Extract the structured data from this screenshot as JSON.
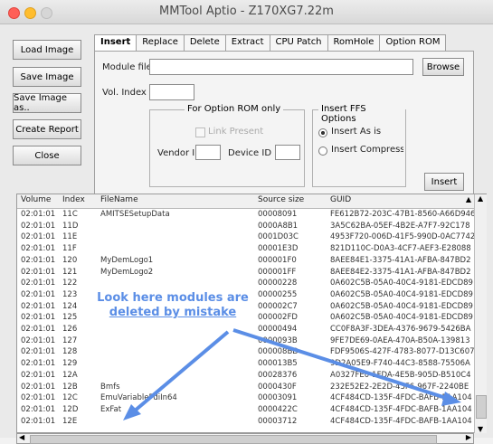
{
  "window": {
    "title": "MMTool Aptio - Z170XG7.22m"
  },
  "colors": {
    "annotation": "#5b8ee6",
    "close": "#ff5f57",
    "minimize": "#ffbd2e",
    "zoom": "#d6d6d6"
  },
  "left_buttons": [
    "Load Image",
    "Save Image",
    "Save Image as..",
    "Create Report",
    "Close"
  ],
  "tabs": [
    "Insert",
    "Replace",
    "Delete",
    "Extract",
    "CPU Patch",
    "RomHole",
    "Option ROM"
  ],
  "insert_panel": {
    "module_file_label": "Module file",
    "module_file_value": "",
    "browse": "Browse",
    "vol_index_label": "Vol. Index",
    "vol_index_value": "",
    "option_rom_group": "For Option ROM only",
    "link_present": "Link Present",
    "vendor_id": "Vendor ID",
    "device_id": "Device ID",
    "ffs_group": "Insert FFS Options",
    "insert_as_is": "Insert As is",
    "insert_compressed": "Insert Compressed",
    "insert_button": "Insert"
  },
  "table": {
    "columns": [
      "Volume",
      "Index",
      "FileName",
      "Source size",
      "GUID"
    ],
    "rows": [
      [
        "02:01:01",
        "11C",
        "AMITSESetupData",
        "00008091",
        "FE612B72-203C-47B1-8560-A66D946"
      ],
      [
        "02:01:01",
        "11D",
        "",
        "0000A8B1",
        "3A5C62BA-05EF-4B2E-A7F7-92C178"
      ],
      [
        "02:01:01",
        "11E",
        "",
        "0001D03C",
        "4953F720-006D-41F5-990D-0AC7742"
      ],
      [
        "02:01:01",
        "11F",
        "",
        "00001E3D",
        "821D110C-D0A3-4CF7-AEF3-E28088"
      ],
      [
        "02:01:01",
        "120",
        "MyDemLogo1",
        "000001F0",
        "8AEE84E1-3375-41A1-AFBA-847BD2"
      ],
      [
        "02:01:01",
        "121",
        "MyDemLogo2",
        "000001FF",
        "8AEE84E2-3375-41A1-AFBA-847BD2"
      ],
      [
        "02:01:01",
        "122",
        "",
        "00000228",
        "0A602C5B-05A0-40C4-9181-EDCD89"
      ],
      [
        "02:01:01",
        "123",
        "",
        "00000255",
        "0A602C5B-05A0-40C4-9181-EDCD89"
      ],
      [
        "02:01:01",
        "124",
        "",
        "000002C7",
        "0A602C5B-05A0-40C4-9181-EDCD89"
      ],
      [
        "02:01:01",
        "125",
        "",
        "000002FD",
        "0A602C5B-05A0-40C4-9181-EDCD89"
      ],
      [
        "02:01:01",
        "126",
        "",
        "00000494",
        "CC0F8A3F-3DEA-4376-9679-5426BA"
      ],
      [
        "02:01:01",
        "127",
        "",
        "0000093B",
        "9FE7DE69-0AEA-470A-B50A-139813"
      ],
      [
        "02:01:01",
        "128",
        "",
        "000008BD",
        "FDF9506S-427F-4783-8077-D13C607"
      ],
      [
        "02:01:01",
        "129",
        "",
        "000013B5",
        "9D2A05E9-F740-44C3-8588-75506A"
      ],
      [
        "02:01:01",
        "12A",
        "",
        "00028376",
        "A0327FE0-1FDA-4E5B-905D-B510C4"
      ],
      [
        "02:01:01",
        "12B",
        "Bmfs",
        "0000430F",
        "232E52E2-2E2D-43F6-967F-2240BE"
      ],
      [
        "02:01:01",
        "12C",
        "EmuVariableFdiIn64",
        "00003091",
        "4CF484CD-135F-4FDC-BAFB-1AA104"
      ],
      [
        "02:01:01",
        "12D",
        "ExFat",
        "0000422C",
        "4CF484CD-135F-4FDC-BAFB-1AA104"
      ],
      [
        "02:01:01",
        "12E",
        "",
        "00003712",
        "4CF484CD-135F-4FDC-BAFB-1AA104"
      ]
    ]
  },
  "annotation": {
    "line1": "Look here modules are",
    "line2": "deleted by mistake"
  }
}
